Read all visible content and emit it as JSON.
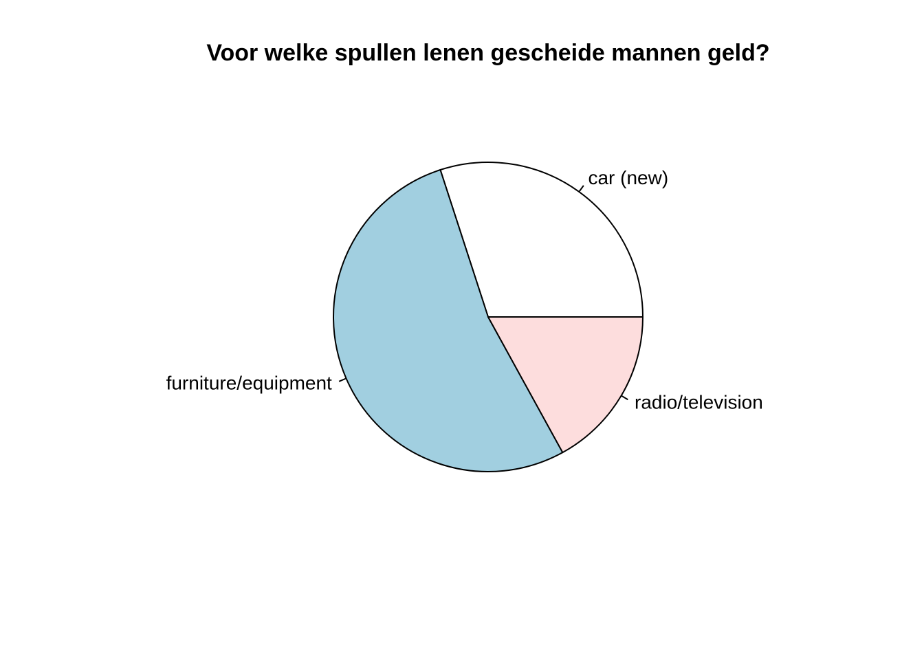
{
  "chart_data": {
    "type": "pie",
    "title": "Voor welke spullen lenen gescheide mannen geld?",
    "categories": [
      "car (new)",
      "furniture/equipment",
      "radio/television"
    ],
    "values": [
      30,
      53,
      17
    ],
    "colors": [
      "#FFFFFF",
      "#A1CFE0",
      "#FDDDDD"
    ],
    "start_angle_deg": 0,
    "direction": "counterclockwise",
    "border_color": "#000000"
  }
}
